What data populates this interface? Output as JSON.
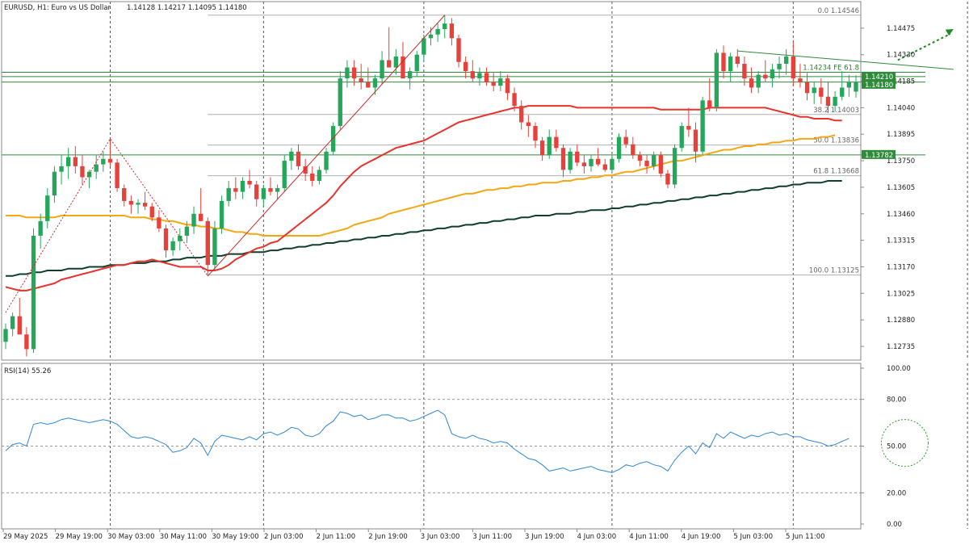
{
  "chart_data": {
    "type": "candlestick",
    "header": {
      "symbol_label": "EURUSD, H1:  Euro vs US Dollar",
      "ohlc_text": "1.14128 1.14217 1.14095 1.14180"
    },
    "price_axis": {
      "ylim": [
        1.1266,
        1.1462
      ],
      "ticks": [
        "1.14475",
        "1.14330",
        "1.14185",
        "1.14040",
        "1.13895",
        "1.13750",
        "1.13605",
        "1.13460",
        "1.13315",
        "1.13170",
        "1.13025",
        "1.12880",
        "1.12735"
      ]
    },
    "time_axis": {
      "tick_labels": [
        "29 May 2025",
        "29 May 19:00",
        "30 May 03:00",
        "30 May 11:00",
        "30 May 19:00",
        "2 Jun 03:00",
        "2 Jun 11:00",
        "2 Jun 19:00",
        "3 Jun 03:00",
        "3 Jun 11:00",
        "3 Jun 19:00",
        "4 Jun 03:00",
        "4 Jun 11:00",
        "4 Jun 19:00",
        "5 Jun 03:00",
        "5 Jun 11:00"
      ],
      "grid_at_bars": [
        15,
        37,
        60,
        87,
        113,
        138,
        153
      ]
    },
    "price_labels": [
      {
        "value": 1.1421,
        "text": "1.14210",
        "style": "green-box"
      },
      {
        "value": 1.1418,
        "text": "1.14180",
        "style": "green-box"
      },
      {
        "value": 1.13782,
        "text": "1.13782",
        "style": "green-box"
      }
    ],
    "fibonacci": {
      "levels": [
        {
          "value": 1.14546,
          "text": "0.0  1.14546"
        },
        {
          "value": 1.14003,
          "text": "38.2  1.14003"
        },
        {
          "value": 1.13836,
          "text": "50.0  1.13836"
        },
        {
          "value": 1.13668,
          "text": "61.8  1.13668"
        },
        {
          "value": 1.13125,
          "text": "100.0  1.13125"
        }
      ],
      "fe_label": {
        "value": 1.14234,
        "text": "1.14234  FE 61.8"
      }
    },
    "horizontal_lines": [
      1.14234,
      1.1421,
      1.1418,
      1.13782
    ],
    "support_zone": {
      "from": 1.1399,
      "to": 1.1402
    },
    "colors": {
      "bull": "#26a65b",
      "bear": "#e8403a",
      "ma_red": "#e8322b",
      "ma_orange": "#f3a712",
      "ma_dark": "#0f3d2e",
      "zigzag": "#cc2a2a",
      "hline": "#2e8b3a",
      "rsi": "#2f86d6",
      "zone": "#f7f200"
    },
    "candles": [
      [
        1.1276,
        1.1286,
        1.1272,
        1.1283
      ],
      [
        1.1283,
        1.1292,
        1.1279,
        1.129
      ],
      [
        1.129,
        1.13,
        1.1286,
        1.128
      ],
      [
        1.128,
        1.1284,
        1.1268,
        1.1272
      ],
      [
        1.1272,
        1.1338,
        1.127,
        1.1334
      ],
      [
        1.1334,
        1.1346,
        1.1327,
        1.1342
      ],
      [
        1.1342,
        1.136,
        1.1338,
        1.1356
      ],
      [
        1.1356,
        1.1372,
        1.1352,
        1.1369
      ],
      [
        1.1369,
        1.1378,
        1.1362,
        1.1372
      ],
      [
        1.1372,
        1.1382,
        1.1365,
        1.1377
      ],
      [
        1.1377,
        1.1383,
        1.1368,
        1.1372
      ],
      [
        1.1372,
        1.1378,
        1.1362,
        1.1366
      ],
      [
        1.1366,
        1.137,
        1.136,
        1.1369
      ],
      [
        1.1369,
        1.1378,
        1.1365,
        1.1373
      ],
      [
        1.1373,
        1.138,
        1.1369,
        1.1376
      ],
      [
        1.1376,
        1.1387,
        1.1372,
        1.1374
      ],
      [
        1.1374,
        1.1376,
        1.1358,
        1.136
      ],
      [
        1.136,
        1.1362,
        1.135,
        1.1353
      ],
      [
        1.1353,
        1.1356,
        1.1346,
        1.1351
      ],
      [
        1.1351,
        1.1354,
        1.1346,
        1.1352
      ],
      [
        1.1352,
        1.1358,
        1.1348,
        1.135
      ],
      [
        1.135,
        1.1352,
        1.1342,
        1.1344
      ],
      [
        1.1344,
        1.1348,
        1.1336,
        1.1338
      ],
      [
        1.1338,
        1.134,
        1.1322,
        1.1326
      ],
      [
        1.1326,
        1.1333,
        1.1323,
        1.1331
      ],
      [
        1.1331,
        1.1338,
        1.1326,
        1.1334
      ],
      [
        1.1334,
        1.1342,
        1.133,
        1.1339
      ],
      [
        1.1339,
        1.135,
        1.1335,
        1.1346
      ],
      [
        1.1346,
        1.136,
        1.1342,
        1.1342
      ],
      [
        1.1342,
        1.1344,
        1.1312,
        1.1318
      ],
      [
        1.1318,
        1.1342,
        1.1315,
        1.1338
      ],
      [
        1.1338,
        1.1356,
        1.1335,
        1.1353
      ],
      [
        1.1353,
        1.1364,
        1.135,
        1.136
      ],
      [
        1.136,
        1.1366,
        1.1354,
        1.1358
      ],
      [
        1.1358,
        1.1366,
        1.1354,
        1.1364
      ],
      [
        1.1364,
        1.137,
        1.136,
        1.1362
      ],
      [
        1.1362,
        1.1364,
        1.135,
        1.1354
      ],
      [
        1.1354,
        1.1362,
        1.135,
        1.136
      ],
      [
        1.136,
        1.1366,
        1.1356,
        1.1358
      ],
      [
        1.1358,
        1.1362,
        1.1354,
        1.136
      ],
      [
        1.136,
        1.1378,
        1.1358,
        1.1375
      ],
      [
        1.1375,
        1.1382,
        1.137,
        1.138
      ],
      [
        1.138,
        1.1384,
        1.137,
        1.1372
      ],
      [
        1.1372,
        1.1376,
        1.1364,
        1.1368
      ],
      [
        1.1368,
        1.1372,
        1.1361,
        1.1364
      ],
      [
        1.1364,
        1.1372,
        1.1362,
        1.137
      ],
      [
        1.137,
        1.1382,
        1.1368,
        1.138
      ],
      [
        1.138,
        1.1396,
        1.1378,
        1.1394
      ],
      [
        1.1394,
        1.1424,
        1.1392,
        1.142
      ],
      [
        1.142,
        1.143,
        1.1415,
        1.1426
      ],
      [
        1.1426,
        1.143,
        1.1416,
        1.142
      ],
      [
        1.142,
        1.1428,
        1.1414,
        1.1418
      ],
      [
        1.1418,
        1.1426,
        1.1415,
        1.1415
      ],
      [
        1.1415,
        1.1422,
        1.1411,
        1.142
      ],
      [
        1.142,
        1.1435,
        1.1417,
        1.143
      ],
      [
        1.143,
        1.1448,
        1.1428,
        1.1426
      ],
      [
        1.1426,
        1.1436,
        1.1422,
        1.1432
      ],
      [
        1.1432,
        1.144,
        1.1425,
        1.142
      ],
      [
        1.142,
        1.1426,
        1.1414,
        1.1424
      ],
      [
        1.1424,
        1.1435,
        1.1421,
        1.1433
      ],
      [
        1.1433,
        1.1444,
        1.143,
        1.1442
      ],
      [
        1.1442,
        1.1448,
        1.1438,
        1.1444
      ],
      [
        1.1444,
        1.145,
        1.144,
        1.1447
      ],
      [
        1.1447,
        1.14546,
        1.1442,
        1.145
      ],
      [
        1.145,
        1.1453,
        1.1438,
        1.1442
      ],
      [
        1.1442,
        1.1444,
        1.1426,
        1.1429
      ],
      [
        1.1429,
        1.1432,
        1.142,
        1.1424
      ],
      [
        1.1424,
        1.143,
        1.1418,
        1.142
      ],
      [
        1.142,
        1.1426,
        1.1416,
        1.1423
      ],
      [
        1.1423,
        1.1426,
        1.1416,
        1.1418
      ],
      [
        1.1418,
        1.1423,
        1.1413,
        1.1416
      ],
      [
        1.1416,
        1.1424,
        1.1413,
        1.142
      ],
      [
        1.142,
        1.1422,
        1.1408,
        1.1412
      ],
      [
        1.1412,
        1.1415,
        1.1402,
        1.1405
      ],
      [
        1.1405,
        1.1408,
        1.1392,
        1.1396
      ],
      [
        1.1396,
        1.14,
        1.1388,
        1.1394
      ],
      [
        1.1394,
        1.1396,
        1.1382,
        1.1386
      ],
      [
        1.1386,
        1.1388,
        1.1375,
        1.1378
      ],
      [
        1.1378,
        1.1392,
        1.1376,
        1.1388
      ],
      [
        1.1388,
        1.1392,
        1.138,
        1.1382
      ],
      [
        1.1382,
        1.1384,
        1.1366,
        1.137
      ],
      [
        1.137,
        1.1382,
        1.1368,
        1.138
      ],
      [
        1.138,
        1.1384,
        1.1372,
        1.1374
      ],
      [
        1.1374,
        1.1378,
        1.1368,
        1.1372
      ],
      [
        1.1372,
        1.1378,
        1.1369,
        1.1376
      ],
      [
        1.1376,
        1.1382,
        1.1372,
        1.1373
      ],
      [
        1.1373,
        1.1376,
        1.1369,
        1.137
      ],
      [
        1.137,
        1.1378,
        1.1368,
        1.1376
      ],
      [
        1.1376,
        1.139,
        1.1374,
        1.1388
      ],
      [
        1.1388,
        1.1392,
        1.1382,
        1.1384
      ],
      [
        1.1384,
        1.1388,
        1.1376,
        1.1378
      ],
      [
        1.1378,
        1.138,
        1.1372,
        1.1375
      ],
      [
        1.1375,
        1.1378,
        1.1368,
        1.1372
      ],
      [
        1.1372,
        1.138,
        1.137,
        1.1378
      ],
      [
        1.1378,
        1.138,
        1.1366,
        1.1368
      ],
      [
        1.1368,
        1.137,
        1.136,
        1.1362
      ],
      [
        1.1362,
        1.1384,
        1.136,
        1.1382
      ],
      [
        1.1382,
        1.1396,
        1.138,
        1.1394
      ],
      [
        1.1394,
        1.1404,
        1.1388,
        1.1392
      ],
      [
        1.1392,
        1.1396,
        1.1374,
        1.138
      ],
      [
        1.138,
        1.141,
        1.1378,
        1.1408
      ],
      [
        1.1408,
        1.142,
        1.1402,
        1.1404
      ],
      [
        1.1404,
        1.1436,
        1.1402,
        1.1434
      ],
      [
        1.1434,
        1.1438,
        1.142,
        1.1424
      ],
      [
        1.1424,
        1.1434,
        1.1418,
        1.1432
      ],
      [
        1.1432,
        1.1436,
        1.1426,
        1.1428
      ],
      [
        1.1428,
        1.1432,
        1.1416,
        1.142
      ],
      [
        1.142,
        1.1426,
        1.1412,
        1.1415
      ],
      [
        1.1415,
        1.1424,
        1.1412,
        1.1422
      ],
      [
        1.1422,
        1.143,
        1.1418,
        1.142
      ],
      [
        1.142,
        1.1428,
        1.1415,
        1.1425
      ],
      [
        1.1425,
        1.1432,
        1.142,
        1.1428
      ],
      [
        1.1428,
        1.1436,
        1.1422,
        1.1432
      ],
      [
        1.1432,
        1.144,
        1.1416,
        1.142
      ],
      [
        1.142,
        1.1428,
        1.1415,
        1.1418
      ],
      [
        1.1418,
        1.1423,
        1.1408,
        1.1412
      ],
      [
        1.1412,
        1.1418,
        1.1406,
        1.1415
      ],
      [
        1.1415,
        1.142,
        1.1406,
        1.141
      ],
      [
        1.141,
        1.1418,
        1.1401,
        1.1405
      ],
      [
        1.1405,
        1.1413,
        1.1402,
        1.141
      ],
      [
        1.141,
        1.1424,
        1.1408,
        1.1415
      ],
      [
        1.1415,
        1.1422,
        1.141,
        1.1418
      ],
      [
        1.14128,
        1.14217,
        1.14095,
        1.1418
      ]
    ],
    "ma_red": [
      1.1306,
      1.1305,
      1.1304,
      1.1304,
      1.1305,
      1.1306,
      1.1307,
      1.1308,
      1.131,
      1.1311,
      1.1312,
      1.1313,
      1.1314,
      1.1315,
      1.1316,
      1.1317,
      1.1318,
      1.1318,
      1.1319,
      1.132,
      1.132,
      1.1321,
      1.132,
      1.1319,
      1.1318,
      1.1317,
      1.1317,
      1.1317,
      1.1317,
      1.1315,
      1.1315,
      1.1316,
      1.1318,
      1.1321,
      1.1323,
      1.1325,
      1.1327,
      1.1328,
      1.133,
      1.1331,
      1.1334,
      1.1337,
      1.134,
      1.1343,
      1.1346,
      1.1349,
      1.1352,
      1.1356,
      1.1361,
      1.1365,
      1.1369,
      1.1372,
      1.1374,
      1.1376,
      1.1378,
      1.138,
      1.1382,
      1.1383,
      1.1384,
      1.1385,
      1.1386,
      1.1388,
      1.139,
      1.1392,
      1.1394,
      1.1396,
      1.1397,
      1.1398,
      1.1399,
      1.14,
      1.1401,
      1.1402,
      1.1403,
      1.1404,
      1.1404,
      1.1405,
      1.1405,
      1.1405,
      1.1405,
      1.1405,
      1.1405,
      1.1405,
      1.1404,
      1.1404,
      1.1404,
      1.1404,
      1.1404,
      1.1404,
      1.1404,
      1.1404,
      1.1404,
      1.1404,
      1.1404,
      1.1404,
      1.1403,
      1.1403,
      1.1403,
      1.1403,
      1.1403,
      1.1403,
      1.1403,
      1.1404,
      1.1404,
      1.1404,
      1.1404,
      1.1404,
      1.1404,
      1.1404,
      1.1404,
      1.1404,
      1.1403,
      1.1402,
      1.1401,
      1.14,
      1.1399,
      1.1399,
      1.1398,
      1.1398,
      1.1398,
      1.1397,
      1.1397
    ],
    "ma_orange": [
      1.1345,
      1.1345,
      1.1345,
      1.1344,
      1.1344,
      1.1344,
      1.1344,
      1.1344,
      1.1345,
      1.1345,
      1.1345,
      1.1345,
      1.1345,
      1.1345,
      1.1345,
      1.1345,
      1.1345,
      1.1345,
      1.1344,
      1.1344,
      1.1344,
      1.1343,
      1.1343,
      1.1342,
      1.1342,
      1.1341,
      1.134,
      1.134,
      1.1339,
      1.1339,
      1.1338,
      1.1338,
      1.1337,
      1.1336,
      1.1336,
      1.1335,
      1.1335,
      1.1334,
      1.1334,
      1.1334,
      1.1334,
      1.1334,
      1.1334,
      1.1334,
      1.1334,
      1.1334,
      1.1335,
      1.1336,
      1.1337,
      1.1338,
      1.134,
      1.1341,
      1.1342,
      1.1343,
      1.1344,
      1.1346,
      1.1347,
      1.1348,
      1.1349,
      1.135,
      1.1351,
      1.1352,
      1.1353,
      1.1354,
      1.1355,
      1.1356,
      1.1357,
      1.1357,
      1.1358,
      1.1359,
      1.1359,
      1.136,
      1.136,
      1.1361,
      1.1361,
      1.1362,
      1.1362,
      1.1363,
      1.1363,
      1.1363,
      1.1364,
      1.1364,
      1.1365,
      1.1365,
      1.1366,
      1.1366,
      1.1367,
      1.1367,
      1.1368,
      1.1369,
      1.1369,
      1.137,
      1.1371,
      1.1372,
      1.1373,
      1.1374,
      1.1375,
      1.1375,
      1.1376,
      1.1377,
      1.1378,
      1.1379,
      1.138,
      1.1381,
      1.1381,
      1.1382,
      1.1383,
      1.1383,
      1.1384,
      1.1384,
      1.1385,
      1.1385,
      1.1386,
      1.1386,
      1.1387,
      1.1387,
      1.1387,
      1.1388,
      1.1388,
      1.1389
    ],
    "ma_dark": [
      1.1312,
      1.1312,
      1.1313,
      1.1313,
      1.1314,
      1.1314,
      1.1315,
      1.1315,
      1.1315,
      1.1316,
      1.1316,
      1.1316,
      1.1317,
      1.1317,
      1.1317,
      1.1318,
      1.1318,
      1.1318,
      1.1319,
      1.1319,
      1.1319,
      1.132,
      1.132,
      1.132,
      1.1321,
      1.1321,
      1.1322,
      1.1322,
      1.1322,
      1.1323,
      1.1323,
      1.1323,
      1.1324,
      1.1324,
      1.1324,
      1.1325,
      1.1325,
      1.1325,
      1.1326,
      1.1326,
      1.1327,
      1.1327,
      1.1328,
      1.1328,
      1.1329,
      1.1329,
      1.133,
      1.133,
      1.1331,
      1.1331,
      1.1332,
      1.1332,
      1.1333,
      1.1333,
      1.1334,
      1.1334,
      1.1335,
      1.1335,
      1.1336,
      1.1336,
      1.1337,
      1.1337,
      1.1338,
      1.1338,
      1.1339,
      1.1339,
      1.134,
      1.134,
      1.1341,
      1.1341,
      1.1342,
      1.1342,
      1.1343,
      1.1343,
      1.1344,
      1.1344,
      1.1345,
      1.1345,
      1.1345,
      1.1346,
      1.1346,
      1.1346,
      1.1347,
      1.1347,
      1.1348,
      1.1348,
      1.1348,
      1.1349,
      1.1349,
      1.135,
      1.135,
      1.1351,
      1.1351,
      1.1352,
      1.1352,
      1.1353,
      1.1353,
      1.1354,
      1.1354,
      1.1355,
      1.1355,
      1.1356,
      1.1356,
      1.1357,
      1.1357,
      1.1358,
      1.1358,
      1.1359,
      1.1359,
      1.136,
      1.136,
      1.1361,
      1.1361,
      1.1362,
      1.1362,
      1.1363,
      1.1363,
      1.1363,
      1.1364,
      1.1364,
      1.1364
    ],
    "zigzag": [
      [
        0,
        1.1292
      ],
      [
        15,
        1.1387
      ],
      [
        29,
        1.1312
      ],
      [
        63,
        1.14546
      ]
    ],
    "trendline": [
      [
        105,
        1.1435
      ],
      [
        136,
        1.1425
      ]
    ],
    "rsi": {
      "label": "RSI(14) 55.26",
      "ylim": [
        0,
        100
      ],
      "ticks": [
        "100.00",
        "80.00",
        "50.00",
        "20.00",
        "0.00"
      ],
      "levels": [
        80,
        50,
        20
      ],
      "values": [
        47,
        51,
        52,
        50,
        64,
        65,
        64,
        65,
        67,
        68,
        67,
        66,
        65,
        66,
        67,
        66,
        64,
        60,
        56,
        55,
        56,
        55,
        53,
        51,
        46,
        47,
        49,
        55,
        52,
        44,
        53,
        57,
        56,
        55,
        54,
        56,
        54,
        58,
        59,
        57,
        59,
        62,
        61,
        57,
        56,
        58,
        63,
        66,
        72,
        71,
        69,
        70,
        67,
        68,
        70,
        70,
        68,
        68,
        66,
        67,
        69,
        71,
        73,
        70,
        58,
        56,
        55,
        57,
        55,
        54,
        52,
        53,
        52,
        48,
        45,
        42,
        41,
        38,
        34,
        35,
        36,
        34,
        35,
        36,
        37,
        35,
        34,
        33,
        35,
        38,
        37,
        39,
        40,
        38,
        37,
        34,
        41,
        46,
        50,
        45,
        52,
        49,
        58,
        55,
        59,
        57,
        55,
        57,
        56,
        58,
        59,
        57,
        58,
        56,
        56,
        54,
        53,
        52,
        50,
        51,
        53,
        55
      ]
    },
    "annotations": [
      {
        "kind": "dashed-arrow",
        "from": [
          128,
          1.143
        ],
        "to": [
          136,
          1.1447
        ]
      },
      {
        "kind": "rsi-circle",
        "at_bar": 129,
        "at_rsi": 52
      }
    ]
  }
}
